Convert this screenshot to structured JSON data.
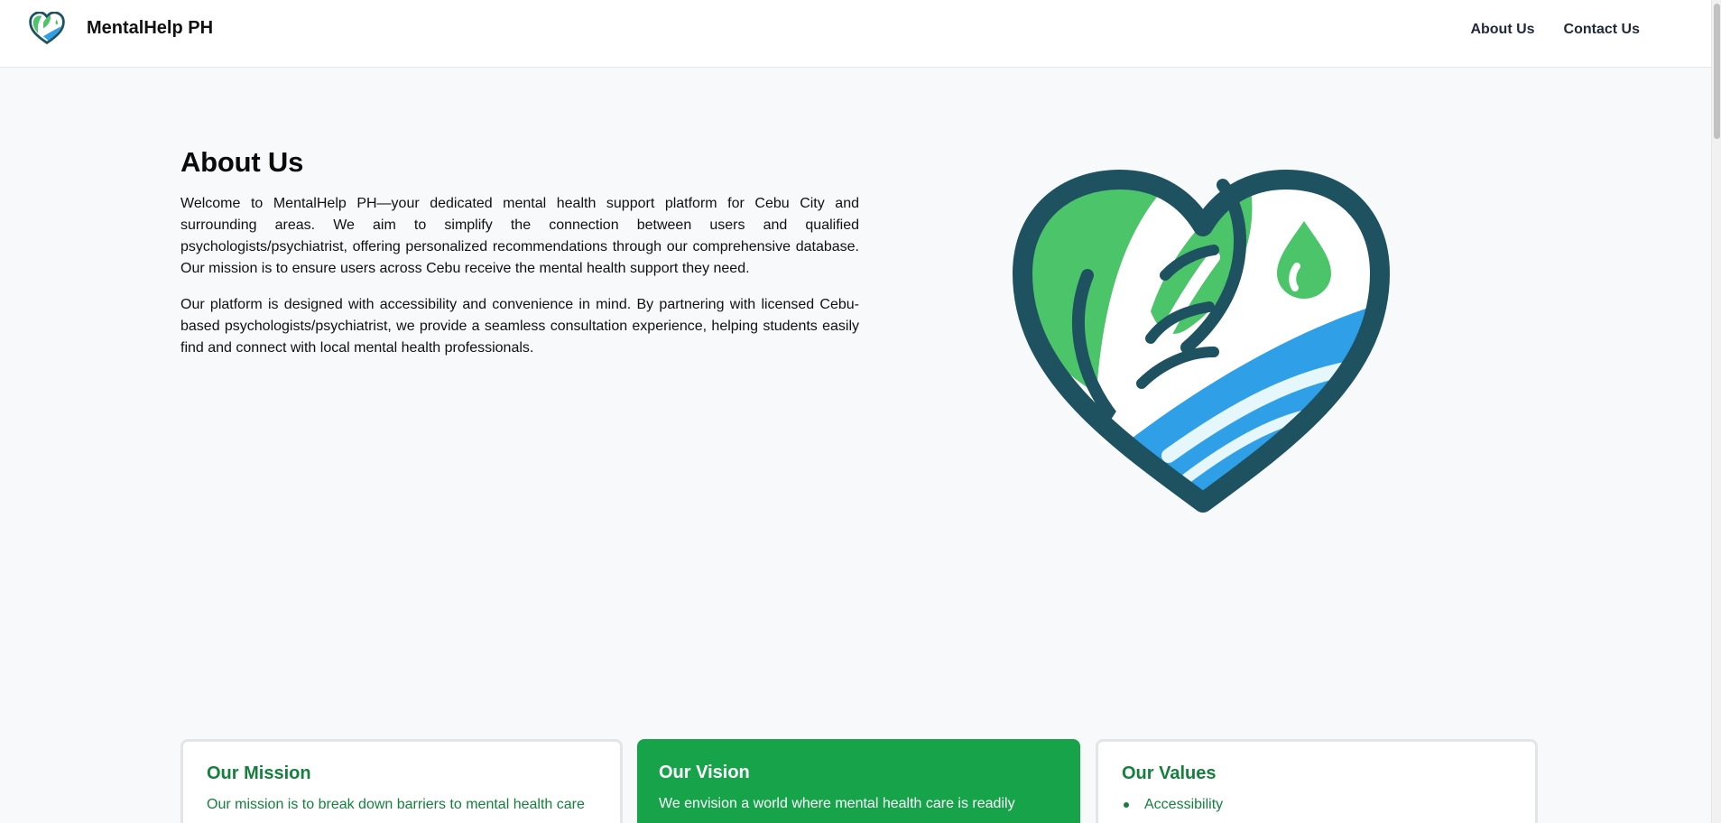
{
  "brand": {
    "name": "MentalHelp PH",
    "logo_icon": "heart-leaf-water-logo"
  },
  "nav": {
    "links": [
      {
        "label": "About Us"
      },
      {
        "label": "Contact Us"
      }
    ]
  },
  "about": {
    "title": "About Us",
    "paragraphs": [
      "Welcome to MentalHelp PH—your dedicated mental health support platform for Cebu City and surrounding areas. We aim to simplify the connection between users and qualified psychologists/psychiatrist, offering personalized recommendations through our comprehensive database. Our mission is to ensure users across Cebu receive the mental health support they need.",
      "Our platform is designed with accessibility and convenience in mind. By partnering with licensed Cebu-based psychologists/psychiatrist, we provide a seamless consultation experience, helping students easily find and connect with local mental health professionals."
    ]
  },
  "cards": {
    "mission": {
      "title": "Our Mission",
      "text": "Our mission is to break down barriers to mental health care"
    },
    "vision": {
      "title": "Our Vision",
      "text": "We envision a world where mental health care is readily"
    },
    "values": {
      "title": "Our Values",
      "items": [
        "Accessibility"
      ]
    }
  },
  "colors": {
    "brand_green": "#16a34a",
    "text_green": "#15803d",
    "logo_dark": "#1e5260",
    "logo_leaf": "#4cc46a",
    "logo_water": "#2f9fe8",
    "background": "#f8f9fb"
  }
}
